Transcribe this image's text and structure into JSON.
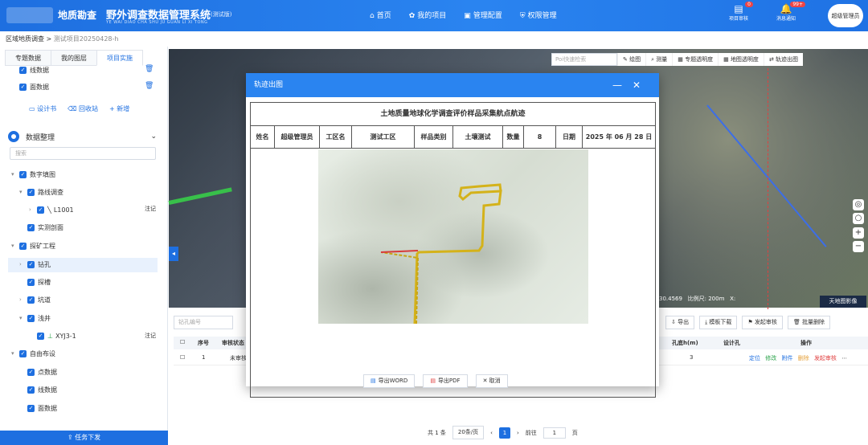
{
  "header": {
    "brand": "地质勘查",
    "title": "野外调查数据管理系统",
    "subtitle": "YE WAI DIAO CHA SHU JU GUAN LI XI TONG",
    "test_tag": "(测试版)",
    "nav": [
      "首页",
      "我的项目",
      "管理配置",
      "权限管理"
    ],
    "review_label": "项目审核",
    "review_badge": "0",
    "notice_label": "消息通知",
    "notice_badge": "99+",
    "user": "超级管理员"
  },
  "breadcrumb": {
    "root": "区域地质调查",
    "current": "测试项目20250428-h"
  },
  "left": {
    "tabs": [
      "专题数据",
      "我的图层",
      "项目实施"
    ],
    "top_items": [
      "线数据",
      "面数据"
    ],
    "links": [
      "设计书",
      "回收站",
      "新增"
    ],
    "section": "数据整理",
    "search_placeholder": "搜索",
    "tree": {
      "digital_map": "数字填图",
      "route": "路线调查",
      "l1001": "L1001",
      "annot": "注记",
      "profile": "实测剖面",
      "mining": "探矿工程",
      "drill": "钻孔",
      "trench": "探槽",
      "tunnel": "坑道",
      "shaft": "浅井",
      "xyj": "XYJ3-1",
      "free": "自由布设",
      "point": "点数据",
      "line": "线数据",
      "area": "面数据"
    },
    "task_button": "任务下发"
  },
  "map": {
    "search_placeholder": "Poi快速检索",
    "tools": [
      "绘图",
      "测量",
      "专题透明度",
      "地图透明度",
      "轨迹出图"
    ],
    "coord": "30.4569",
    "scale": "比例尺: 200m",
    "x_label": "X:",
    "basemap_btn": "天地图影像"
  },
  "table": {
    "search_placeholder": "钻孔编号",
    "right_buttons": [
      "导出",
      "模板下载",
      "发起审核",
      "批量删除"
    ],
    "headers": [
      "序号",
      "审核状态",
      "孔底h(m)",
      "设计孔",
      "操作"
    ],
    "row": {
      "index": "1",
      "status": "未审核",
      "depth": "3",
      "ops": [
        "定位",
        "修改",
        "附件",
        "删除",
        "发起审核"
      ]
    }
  },
  "pager": {
    "total": "共 1 条",
    "size": "20条/页",
    "current": "1",
    "goto": "前往",
    "goto_value": "1",
    "page_unit": "页"
  },
  "modal": {
    "title": "轨迹出图",
    "doc_title": "土地质量地球化学调查评价样品采集航点航迹",
    "fields": [
      "姓名",
      "超级管理员",
      "工区名",
      "测试工区",
      "样品类别",
      "土壤测试",
      "数量",
      "8",
      "日期",
      "2025 年 06 月 28 日"
    ],
    "buttons": [
      "导出WORD",
      "导出PDF",
      "取消"
    ]
  },
  "colors": {
    "primary": "#1e6fe0",
    "header": "#2a84f0",
    "track": "#d4b21a",
    "track_red": "#d83a3a"
  }
}
